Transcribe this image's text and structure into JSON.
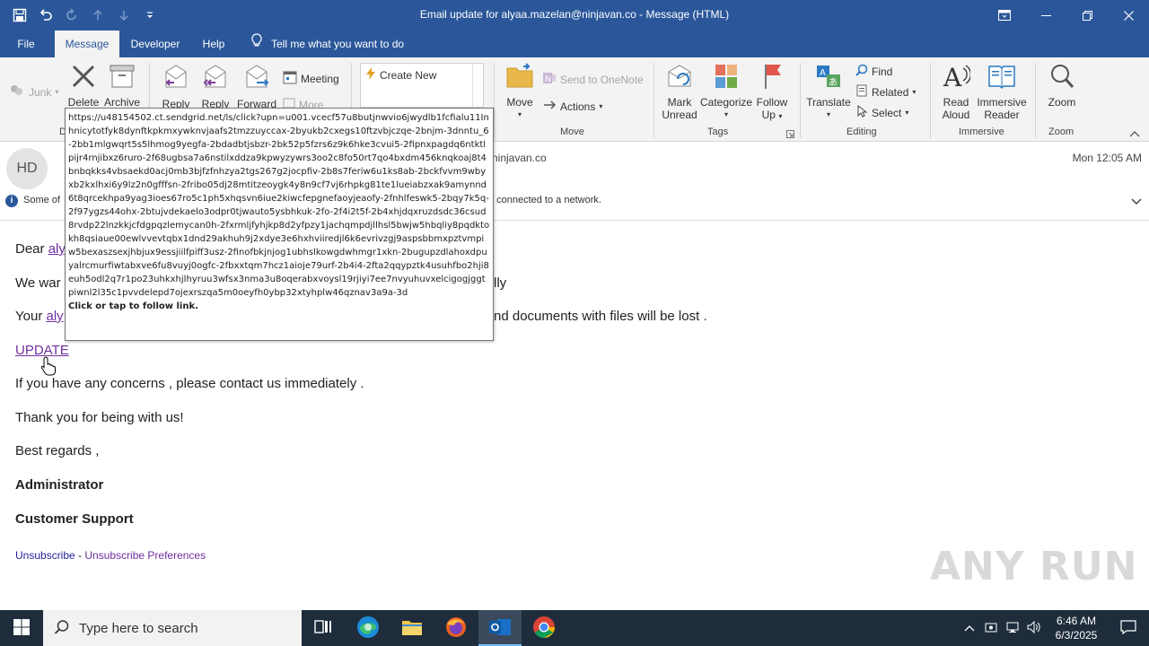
{
  "window": {
    "title": "Email update for alyaa.mazelan@ninjavan.co  -  Message (HTML)"
  },
  "tabs": [
    {
      "label": "File"
    },
    {
      "label": "Message"
    },
    {
      "label": "Developer"
    },
    {
      "label": "Help"
    }
  ],
  "tellme": "Tell me what you want to do",
  "ribbon": {
    "junk": "Junk",
    "delete": "Delete",
    "archive": "Archive",
    "reply": "Reply",
    "reply_all": "Reply",
    "forward": "Forward",
    "meeting": "Meeting",
    "more": "More",
    "quicksteps_create_new": "Create New",
    "move": "Move",
    "send_to_onenote": "Send to OneNote",
    "actions": "Actions",
    "group_move": "Move",
    "mark_unread_1": "Mark",
    "mark_unread_2": "Unread",
    "categorize": "Categorize",
    "follow_up_1": "Follow",
    "follow_up_2": "Up",
    "group_tags": "Tags",
    "translate": "Translate",
    "find": "Find",
    "related": "Related",
    "select": "Select",
    "group_editing": "Editing",
    "read_aloud_1": "Read",
    "read_aloud_2": "Aloud",
    "immersive_reader_1": "Immersive",
    "immersive_reader_2": "Reader",
    "group_immersive": "Immersive",
    "zoom": "Zoom",
    "group_zoom": "Zoom",
    "group_delete_partial": "D"
  },
  "header": {
    "avatar_initials": "HD",
    "from_partial": "ninjavan.co",
    "date": "Mon 12:05 AM",
    "info_left": "Some of",
    "info_right": "t connected to a network."
  },
  "body": {
    "dear_prefix": "Dear",
    "dear_link": "aly",
    "line2_prefix": "We war",
    "line2_suffix": "lly",
    "line3_prefix": "Your",
    "line3_link": "aly",
    "line3_suffix": "nd documents with files will be lost .",
    "update_link": "UPDATE",
    "line_contact": "If you  have any concerns , please contact us immediately .",
    "line_thanks": "Thank you for being with us!",
    "line_regards": "Best regards ,",
    "line_admin": "Administrator",
    "line_support": "Customer Support",
    "unsubscribe": "Unsubscribe",
    "dash": " - ",
    "unsubscribe_prefs": "Unsubscribe Preferences"
  },
  "tooltip": {
    "url": "https://u48154502.ct.sendgrid.net/ls/click?upn=u001.vcecf57u8butjnwvio6jwydlb1fcfialu11Inhnicytotfyk8dynftkpkmxywknvjaafs2tmzzuyccax-2byukb2cxegs10ftzvbjczqe-2bnjm-3dnntu_6-2bb1mlgwqrt5s5lhmog9yegfa-2bdadbtjsbzr-2bk52p5fzrs6z9k6hke3cvui5-2fipnxpagdq6ntktlpijr4rnjibxz6ruro-2f68ugbsa7a6nstilxddza9kpwyzywrs3oo2c8fo50rt7qo4bxdm456knqkoaj8t4bnbqkks4vbsaekd0acj0mb3bjfzfnhzya2tgs267g2jocpfiv-2b8s7feriw6u1ks8ab-2bckfvvm9wbyxb2kxlhxi6y9lz2n0gfffsn-2fribo05dj28mtitzeoygk4y8n9cf7vj6rhpkg81te1lueiabzxak9amynnd6t8qrcekhpa9yag3ioes67ro5c1ph5xhqsvn6iue2kiwcfepgnefaoyjeaofy-2fnhlfeswk5-2bqy7k5q-2f97ygzs44ohx-2btujvdekaelo3odpr0tjwauto5ysbhkuk-2fo-2f4i2t5f-2b4xhjdqxruzdsdc36csud8rvdp22lnzkkjcfdgpqzlemycan0h-2fxrmljfyhjkp8d2yfpzy1jachqmpdjllhsl5bwjw5hbqliy8pqdktokh8qsiaue00ewlvvevtqbx1dnd29akhuh9j2xdye3e6hxhviiredjl6k6evrivzgj9aspsbbmxpztvmpiw5bexaszsexjhbjux9essjiilfpiff3usz-2finofbkjnjog1ubhslkowgdwhmgr1xkn-2bugupzdlahoxdpuyalrcmurfiwtabxve6fu8vuyj0ogfc-2fbxxtqm7hcz1aioje79urf-2b4i4-2fta2qqypztk4usuhfbo2hji8euh5odl2q7r1po23uhkxhjlhyruu3wfsx3nma3u8oqerabxvoysl19rjiyi7ee7nvyuhuvxelcigogjggtpiwnl2l35c1pvvdelepd7ojexrszqa5m0oeyfh0ybp32xtyhplw46qznav3a9a-3d",
    "hint": "Click or tap to follow link."
  },
  "watermark": "ANY RUN",
  "taskbar": {
    "search_placeholder": "Type here to search",
    "time": "6:46 AM",
    "date": "6/3/2025"
  },
  "colors": {
    "title_bar": "#2b579a",
    "ribbon": "#f3f3f3",
    "link": "#7030a0",
    "taskbar": "#1e2c3c"
  }
}
